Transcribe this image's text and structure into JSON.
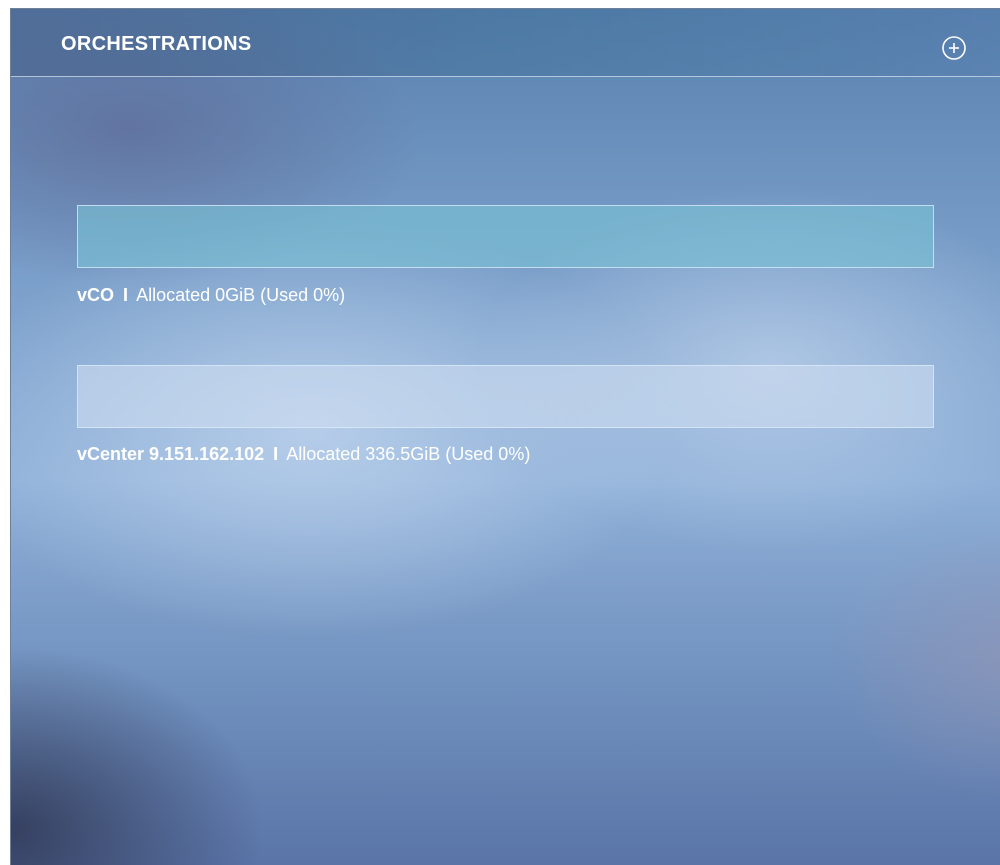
{
  "header": {
    "title": "ORCHESTRATIONS",
    "add_icon": "plus-circle-icon"
  },
  "orchestrations": [
    {
      "name": "vCO",
      "separator": "I",
      "allocation_text": "Allocated 0GiB (Used 0%)",
      "used_fraction": 0.0
    },
    {
      "name": "vCenter 9.151.162.102",
      "separator": "I",
      "allocation_text": "Allocated 336.5GiB (Used 0%)",
      "used_fraction": 0.0
    }
  ]
}
